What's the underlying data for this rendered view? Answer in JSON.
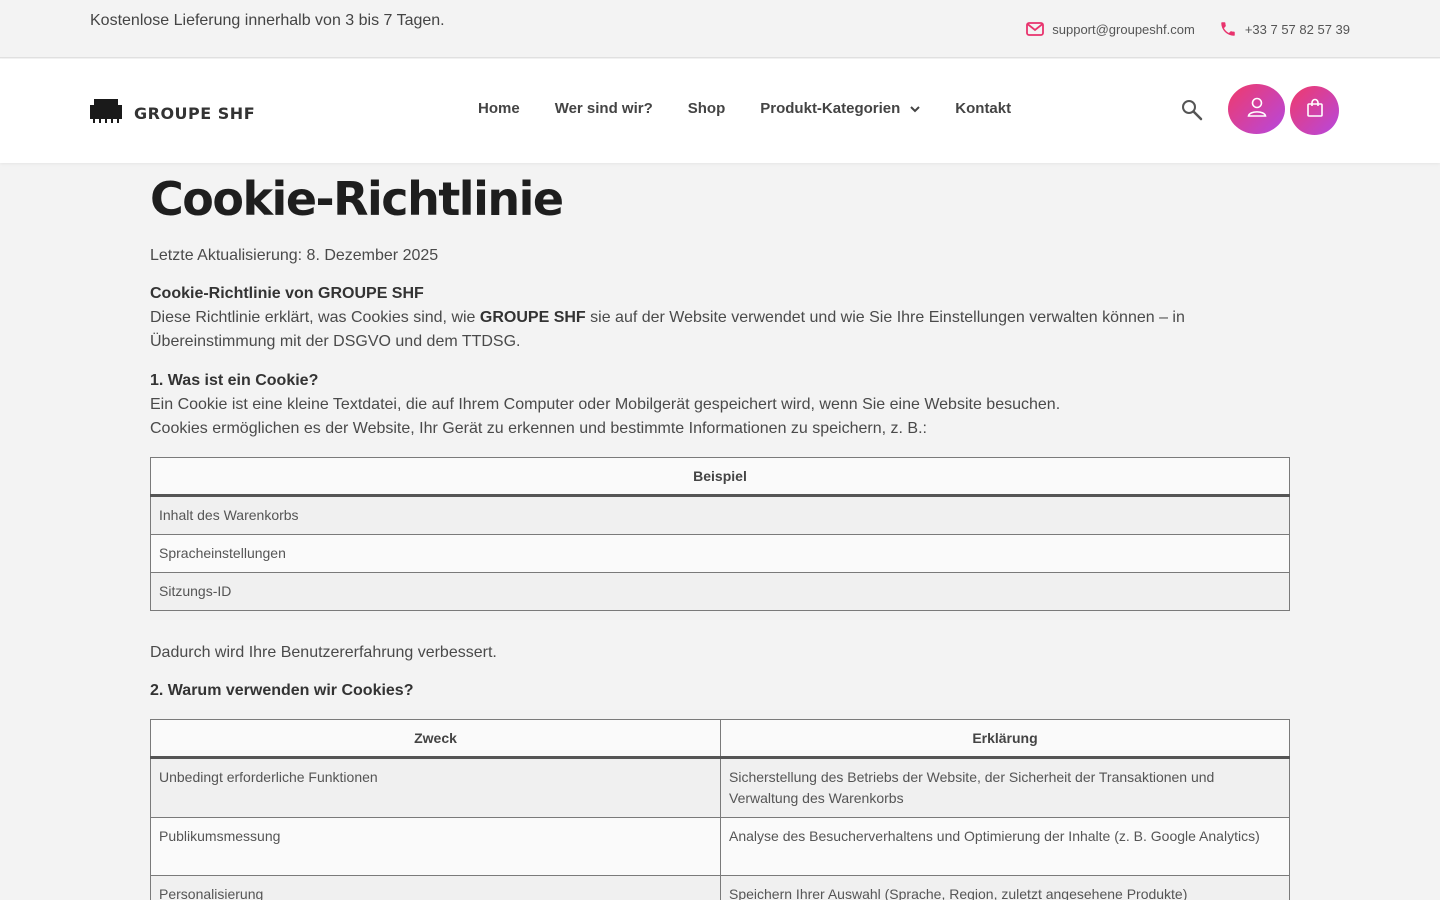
{
  "topbar": {
    "promo": "Kostenlose Lieferung innerhalb von 3 bis 7 Tagen.",
    "email": "support@groupeshf.com",
    "phone": "+33 7 57 82 57 39"
  },
  "header": {
    "logo_text": "GROUPE SHF",
    "nav": [
      "Home",
      "Wer sind wir?",
      "Shop",
      "Produkt-Kategorien",
      "Kontakt"
    ],
    "accent": "#f03a6a",
    "accent2": "#b548e0"
  },
  "content": {
    "title": "Cookie-Richtlinie",
    "last_update": "Letzte Aktualisierung: 8. Dezember 2025",
    "intro_heading": "Cookie-Richtlinie von GROUPE SHF",
    "intro_pre": "Diese Richtlinie erklärt, was Cookies sind, wie ",
    "intro_brand": "GROUPE SHF",
    "intro_post": " sie auf der Website verwendet und wie Sie Ihre Einstellungen verwalten können – in Übereinstimmung mit der DSGVO und dem TTDSG.",
    "s1_heading": "1. Was ist ein Cookie?",
    "s1_line1": "Ein Cookie ist eine kleine Textdatei, die auf Ihrem Computer oder Mobilgerät gespeichert wird, wenn Sie eine Website besuchen.",
    "s1_line2": "Cookies ermöglichen es der Website, Ihr Gerät zu erkennen und bestimmte Informationen zu speichern, z. B.:",
    "table1": {
      "header": "Beispiel",
      "rows": [
        "Inhalt des Warenkorbs",
        "Spracheinstellungen",
        "Sitzungs-ID"
      ]
    },
    "after_table1": "Dadurch wird Ihre Benutzererfahrung verbessert.",
    "s2_heading": "2. Warum verwenden wir Cookies?",
    "table2": {
      "headers": [
        "Zweck",
        "Erklärung"
      ],
      "rows": [
        [
          "Unbedingt erforderliche Funktionen",
          "Sicherstellung des Betriebs der Website, der Sicherheit der Transaktionen und Verwaltung des Warenkorbs"
        ],
        [
          "Publikumsmessung",
          "Analyse des Besucherverhaltens und Optimierung der Inhalte (z. B. Google Analytics)"
        ],
        [
          "Personalisierung",
          "Speichern Ihrer Auswahl (Sprache, Region, zuletzt angesehene Produkte)"
        ]
      ]
    }
  }
}
